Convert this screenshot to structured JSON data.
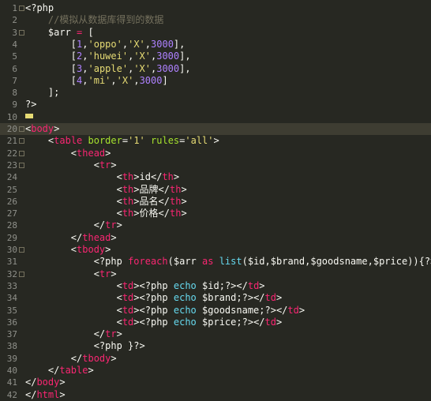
{
  "editor": {
    "current_line": 10,
    "lines": [
      {
        "n": "1",
        "tokens": [
          [
            "php",
            "<?php"
          ]
        ]
      },
      {
        "n": "2",
        "tokens": [
          [
            "text",
            "    "
          ],
          [
            "cmt",
            "//模拟从数据库得到的数据"
          ]
        ]
      },
      {
        "n": "3",
        "tokens": [
          [
            "text",
            "    "
          ],
          [
            "var",
            "$arr"
          ],
          [
            "text",
            " "
          ],
          [
            "kw",
            "="
          ],
          [
            "text",
            " ["
          ]
        ]
      },
      {
        "n": "4",
        "tokens": [
          [
            "text",
            "        ["
          ],
          [
            "num",
            "1"
          ],
          [
            "text",
            ","
          ],
          [
            "str",
            "'oppo'"
          ],
          [
            "text",
            ","
          ],
          [
            "str",
            "'X'"
          ],
          [
            "text",
            ","
          ],
          [
            "num",
            "3000"
          ],
          [
            "text",
            "],"
          ]
        ]
      },
      {
        "n": "5",
        "tokens": [
          [
            "text",
            "        ["
          ],
          [
            "num",
            "2"
          ],
          [
            "text",
            ","
          ],
          [
            "str",
            "'huwei'"
          ],
          [
            "text",
            ","
          ],
          [
            "str",
            "'X'"
          ],
          [
            "text",
            ","
          ],
          [
            "num",
            "3000"
          ],
          [
            "text",
            "],"
          ]
        ]
      },
      {
        "n": "6",
        "tokens": [
          [
            "text",
            "        ["
          ],
          [
            "num",
            "3"
          ],
          [
            "text",
            ","
          ],
          [
            "str",
            "'apple'"
          ],
          [
            "text",
            ","
          ],
          [
            "str",
            "'X'"
          ],
          [
            "text",
            ","
          ],
          [
            "num",
            "3000"
          ],
          [
            "text",
            "],"
          ]
        ]
      },
      {
        "n": "7",
        "tokens": [
          [
            "text",
            "        ["
          ],
          [
            "num",
            "4"
          ],
          [
            "text",
            ","
          ],
          [
            "str",
            "'mi'"
          ],
          [
            "text",
            ","
          ],
          [
            "str",
            "'X'"
          ],
          [
            "text",
            ","
          ],
          [
            "num",
            "3000"
          ],
          [
            "text",
            "]"
          ]
        ]
      },
      {
        "n": "8",
        "tokens": [
          [
            "text",
            "    ];"
          ]
        ]
      },
      {
        "n": "9",
        "tokens": [
          [
            "php",
            "?>"
          ]
        ]
      },
      {
        "n": "10",
        "tokens": [
          [
            "cursor",
            ""
          ]
        ]
      },
      {
        "n": "20",
        "tokens": [
          [
            "punc",
            "<"
          ],
          [
            "tag",
            "body"
          ],
          [
            "punc",
            ">"
          ]
        ]
      },
      {
        "n": "21",
        "tokens": [
          [
            "text",
            "    "
          ],
          [
            "punc",
            "<"
          ],
          [
            "tag",
            "table"
          ],
          [
            "text",
            " "
          ],
          [
            "attr",
            "border"
          ],
          [
            "punc",
            "="
          ],
          [
            "str",
            "'1'"
          ],
          [
            "text",
            " "
          ],
          [
            "attr",
            "rules"
          ],
          [
            "punc",
            "="
          ],
          [
            "str",
            "'all'"
          ],
          [
            "punc",
            ">"
          ]
        ]
      },
      {
        "n": "22",
        "tokens": [
          [
            "text",
            "        "
          ],
          [
            "punc",
            "<"
          ],
          [
            "tag",
            "thead"
          ],
          [
            "punc",
            ">"
          ]
        ]
      },
      {
        "n": "23",
        "tokens": [
          [
            "text",
            "            "
          ],
          [
            "punc",
            "<"
          ],
          [
            "tag",
            "tr"
          ],
          [
            "punc",
            ">"
          ]
        ]
      },
      {
        "n": "24",
        "tokens": [
          [
            "text",
            "                "
          ],
          [
            "punc",
            "<"
          ],
          [
            "tag",
            "th"
          ],
          [
            "punc",
            ">"
          ],
          [
            "text",
            "id"
          ],
          [
            "punc",
            "</"
          ],
          [
            "tag",
            "th"
          ],
          [
            "punc",
            ">"
          ]
        ]
      },
      {
        "n": "25",
        "tokens": [
          [
            "text",
            "                "
          ],
          [
            "punc",
            "<"
          ],
          [
            "tag",
            "th"
          ],
          [
            "punc",
            ">"
          ],
          [
            "text",
            "品牌"
          ],
          [
            "punc",
            "</"
          ],
          [
            "tag",
            "th"
          ],
          [
            "punc",
            ">"
          ]
        ]
      },
      {
        "n": "26",
        "tokens": [
          [
            "text",
            "                "
          ],
          [
            "punc",
            "<"
          ],
          [
            "tag",
            "th"
          ],
          [
            "punc",
            ">"
          ],
          [
            "text",
            "品名"
          ],
          [
            "punc",
            "</"
          ],
          [
            "tag",
            "th"
          ],
          [
            "punc",
            ">"
          ]
        ]
      },
      {
        "n": "27",
        "tokens": [
          [
            "text",
            "                "
          ],
          [
            "punc",
            "<"
          ],
          [
            "tag",
            "th"
          ],
          [
            "punc",
            ">"
          ],
          [
            "text",
            "价格"
          ],
          [
            "punc",
            "</"
          ],
          [
            "tag",
            "th"
          ],
          [
            "punc",
            ">"
          ]
        ]
      },
      {
        "n": "28",
        "tokens": [
          [
            "text",
            "            "
          ],
          [
            "punc",
            "</"
          ],
          [
            "tag",
            "tr"
          ],
          [
            "punc",
            ">"
          ]
        ]
      },
      {
        "n": "29",
        "tokens": [
          [
            "text",
            "        "
          ],
          [
            "punc",
            "</"
          ],
          [
            "tag",
            "thead"
          ],
          [
            "punc",
            ">"
          ]
        ]
      },
      {
        "n": "30",
        "tokens": [
          [
            "text",
            "        "
          ],
          [
            "punc",
            "<"
          ],
          [
            "tag",
            "tbody"
          ],
          [
            "punc",
            ">"
          ]
        ]
      },
      {
        "n": "31",
        "tokens": [
          [
            "text",
            "            "
          ],
          [
            "php",
            "<?php"
          ],
          [
            "text",
            " "
          ],
          [
            "kw",
            "foreach"
          ],
          [
            "text",
            "("
          ],
          [
            "var",
            "$arr"
          ],
          [
            "text",
            " "
          ],
          [
            "kw",
            "as"
          ],
          [
            "text",
            " "
          ],
          [
            "fn",
            "list"
          ],
          [
            "text",
            "("
          ],
          [
            "var",
            "$id"
          ],
          [
            "text",
            ","
          ],
          [
            "var",
            "$brand"
          ],
          [
            "text",
            ","
          ],
          [
            "var",
            "$goodsname"
          ],
          [
            "text",
            ","
          ],
          [
            "var",
            "$price"
          ],
          [
            "text",
            ")){"
          ],
          [
            "php",
            "?>"
          ]
        ]
      },
      {
        "n": "32",
        "tokens": [
          [
            "text",
            "            "
          ],
          [
            "punc",
            "<"
          ],
          [
            "tag",
            "tr"
          ],
          [
            "punc",
            ">"
          ]
        ]
      },
      {
        "n": "33",
        "tokens": [
          [
            "text",
            "                "
          ],
          [
            "punc",
            "<"
          ],
          [
            "tag",
            "td"
          ],
          [
            "punc",
            ">"
          ],
          [
            "php",
            "<?php"
          ],
          [
            "text",
            " "
          ],
          [
            "fn",
            "echo"
          ],
          [
            "text",
            " "
          ],
          [
            "var",
            "$id"
          ],
          [
            "text",
            ";"
          ],
          [
            "php",
            "?>"
          ],
          [
            "punc",
            "</"
          ],
          [
            "tag",
            "td"
          ],
          [
            "punc",
            ">"
          ]
        ]
      },
      {
        "n": "34",
        "tokens": [
          [
            "text",
            "                "
          ],
          [
            "punc",
            "<"
          ],
          [
            "tag",
            "td"
          ],
          [
            "punc",
            ">"
          ],
          [
            "php",
            "<?php"
          ],
          [
            "text",
            " "
          ],
          [
            "fn",
            "echo"
          ],
          [
            "text",
            " "
          ],
          [
            "var",
            "$brand"
          ],
          [
            "text",
            ";"
          ],
          [
            "php",
            "?>"
          ],
          [
            "punc",
            "</"
          ],
          [
            "tag",
            "td"
          ],
          [
            "punc",
            ">"
          ]
        ]
      },
      {
        "n": "35",
        "tokens": [
          [
            "text",
            "                "
          ],
          [
            "punc",
            "<"
          ],
          [
            "tag",
            "td"
          ],
          [
            "punc",
            ">"
          ],
          [
            "php",
            "<?php"
          ],
          [
            "text",
            " "
          ],
          [
            "fn",
            "echo"
          ],
          [
            "text",
            " "
          ],
          [
            "var",
            "$goodsname"
          ],
          [
            "text",
            ";"
          ],
          [
            "php",
            "?>"
          ],
          [
            "punc",
            "</"
          ],
          [
            "tag",
            "td"
          ],
          [
            "punc",
            ">"
          ]
        ]
      },
      {
        "n": "36",
        "tokens": [
          [
            "text",
            "                "
          ],
          [
            "punc",
            "<"
          ],
          [
            "tag",
            "td"
          ],
          [
            "punc",
            ">"
          ],
          [
            "php",
            "<?php"
          ],
          [
            "text",
            " "
          ],
          [
            "fn",
            "echo"
          ],
          [
            "text",
            " "
          ],
          [
            "var",
            "$price"
          ],
          [
            "text",
            ";"
          ],
          [
            "php",
            "?>"
          ],
          [
            "punc",
            "</"
          ],
          [
            "tag",
            "td"
          ],
          [
            "punc",
            ">"
          ]
        ]
      },
      {
        "n": "37",
        "tokens": [
          [
            "text",
            "            "
          ],
          [
            "punc",
            "</"
          ],
          [
            "tag",
            "tr"
          ],
          [
            "punc",
            ">"
          ]
        ]
      },
      {
        "n": "38",
        "tokens": [
          [
            "text",
            "            "
          ],
          [
            "php",
            "<?php"
          ],
          [
            "text",
            " }"
          ],
          [
            "php",
            "?>"
          ]
        ]
      },
      {
        "n": "39",
        "tokens": [
          [
            "text",
            "        "
          ],
          [
            "punc",
            "</"
          ],
          [
            "tag",
            "tbody"
          ],
          [
            "punc",
            ">"
          ]
        ]
      },
      {
        "n": "40",
        "tokens": [
          [
            "text",
            "    "
          ],
          [
            "punc",
            "</"
          ],
          [
            "tag",
            "table"
          ],
          [
            "punc",
            ">"
          ]
        ]
      },
      {
        "n": "41",
        "tokens": [
          [
            "punc",
            "</"
          ],
          [
            "tag",
            "body"
          ],
          [
            "punc",
            ">"
          ]
        ]
      },
      {
        "n": "42",
        "tokens": [
          [
            "punc",
            "</"
          ],
          [
            "tag",
            "html"
          ],
          [
            "punc",
            ">"
          ]
        ]
      }
    ]
  }
}
